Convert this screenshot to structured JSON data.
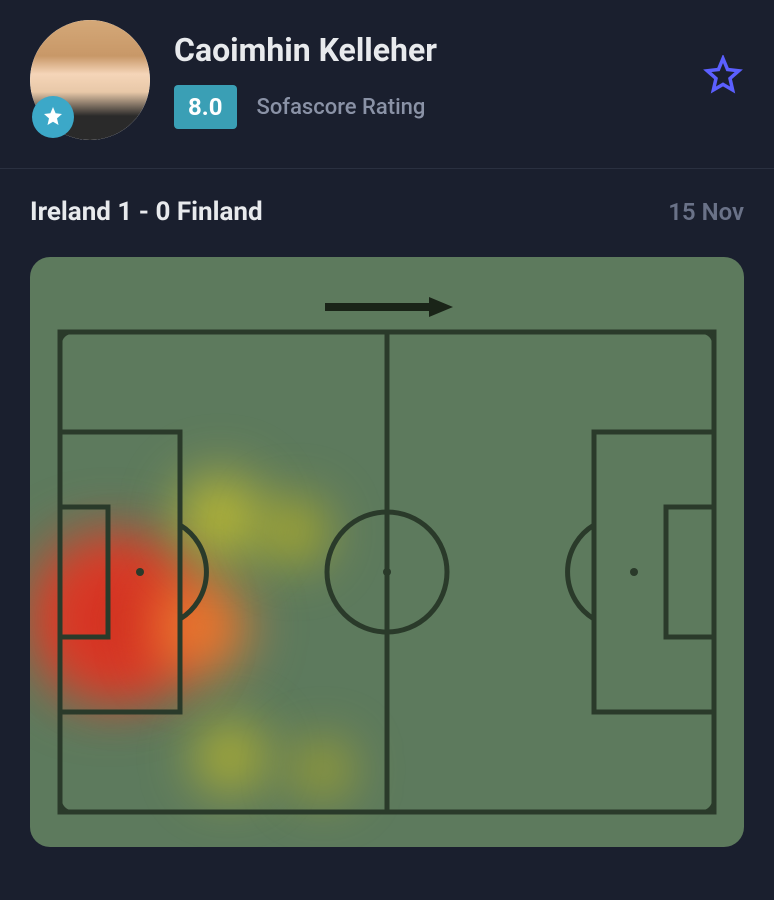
{
  "player": {
    "name": "Caoimhin Kelleher",
    "rating": "8.0",
    "rating_label": "Sofascore Rating"
  },
  "match": {
    "score_text": "Ireland 1 - 0 Finland",
    "date": "15 Nov"
  },
  "colors": {
    "rating_bg": "#3a9fb5",
    "star": "#5b5fff",
    "badge": "#3ca8c8",
    "pitch": "#5d7a5d"
  },
  "chart_data": {
    "type": "heatmap",
    "title": "Player Heatmap",
    "pitch_dimensions": {
      "width": 100,
      "height": 100,
      "direction": "left-to-right"
    },
    "heat_points": [
      {
        "x": 6,
        "y": 50,
        "intensity": 1.0,
        "radius": 22
      },
      {
        "x": 12,
        "y": 50,
        "intensity": 0.95,
        "radius": 20
      },
      {
        "x": 20,
        "y": 52,
        "intensity": 0.6,
        "radius": 15
      },
      {
        "x": 28,
        "y": 48,
        "intensity": 0.4,
        "radius": 12
      },
      {
        "x": 22,
        "y": 38,
        "intensity": 0.35,
        "radius": 10
      },
      {
        "x": 35,
        "y": 40,
        "intensity": 0.25,
        "radius": 8
      },
      {
        "x": 28,
        "y": 75,
        "intensity": 0.25,
        "radius": 9
      },
      {
        "x": 40,
        "y": 78,
        "intensity": 0.2,
        "radius": 7
      }
    ],
    "legend": {
      "low": "yellow",
      "high": "red"
    }
  }
}
